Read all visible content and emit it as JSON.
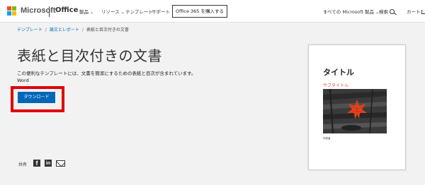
{
  "nav": {
    "brand": "Microsoft",
    "product": "Office",
    "products": "製品",
    "resources": "リソース",
    "templates": "テンプレート",
    "support": "サポート",
    "buy": "Office 365 を購入する",
    "all_microsoft": "すべての Microsoft 製品",
    "search": "検索",
    "cart": "カート"
  },
  "breadcrumb": {
    "templates": "テンプレート",
    "papers": "論文とレポート",
    "current": "表紙と目次付きの文書"
  },
  "main": {
    "title": "表紙と目次付きの文書",
    "description": "この便利なテンプレートには、文書を簡潔にするための表紙と目次が含まれています。",
    "app": "Word",
    "download": "ダウンロード"
  },
  "share": {
    "label": "共有"
  },
  "preview": {
    "title": "タイトル",
    "subtitle": "サブタイトル",
    "author": "作成者"
  },
  "colors": {
    "accent": "#0067b8",
    "highlight": "#e10000",
    "subtitle": "#e94b3c"
  }
}
